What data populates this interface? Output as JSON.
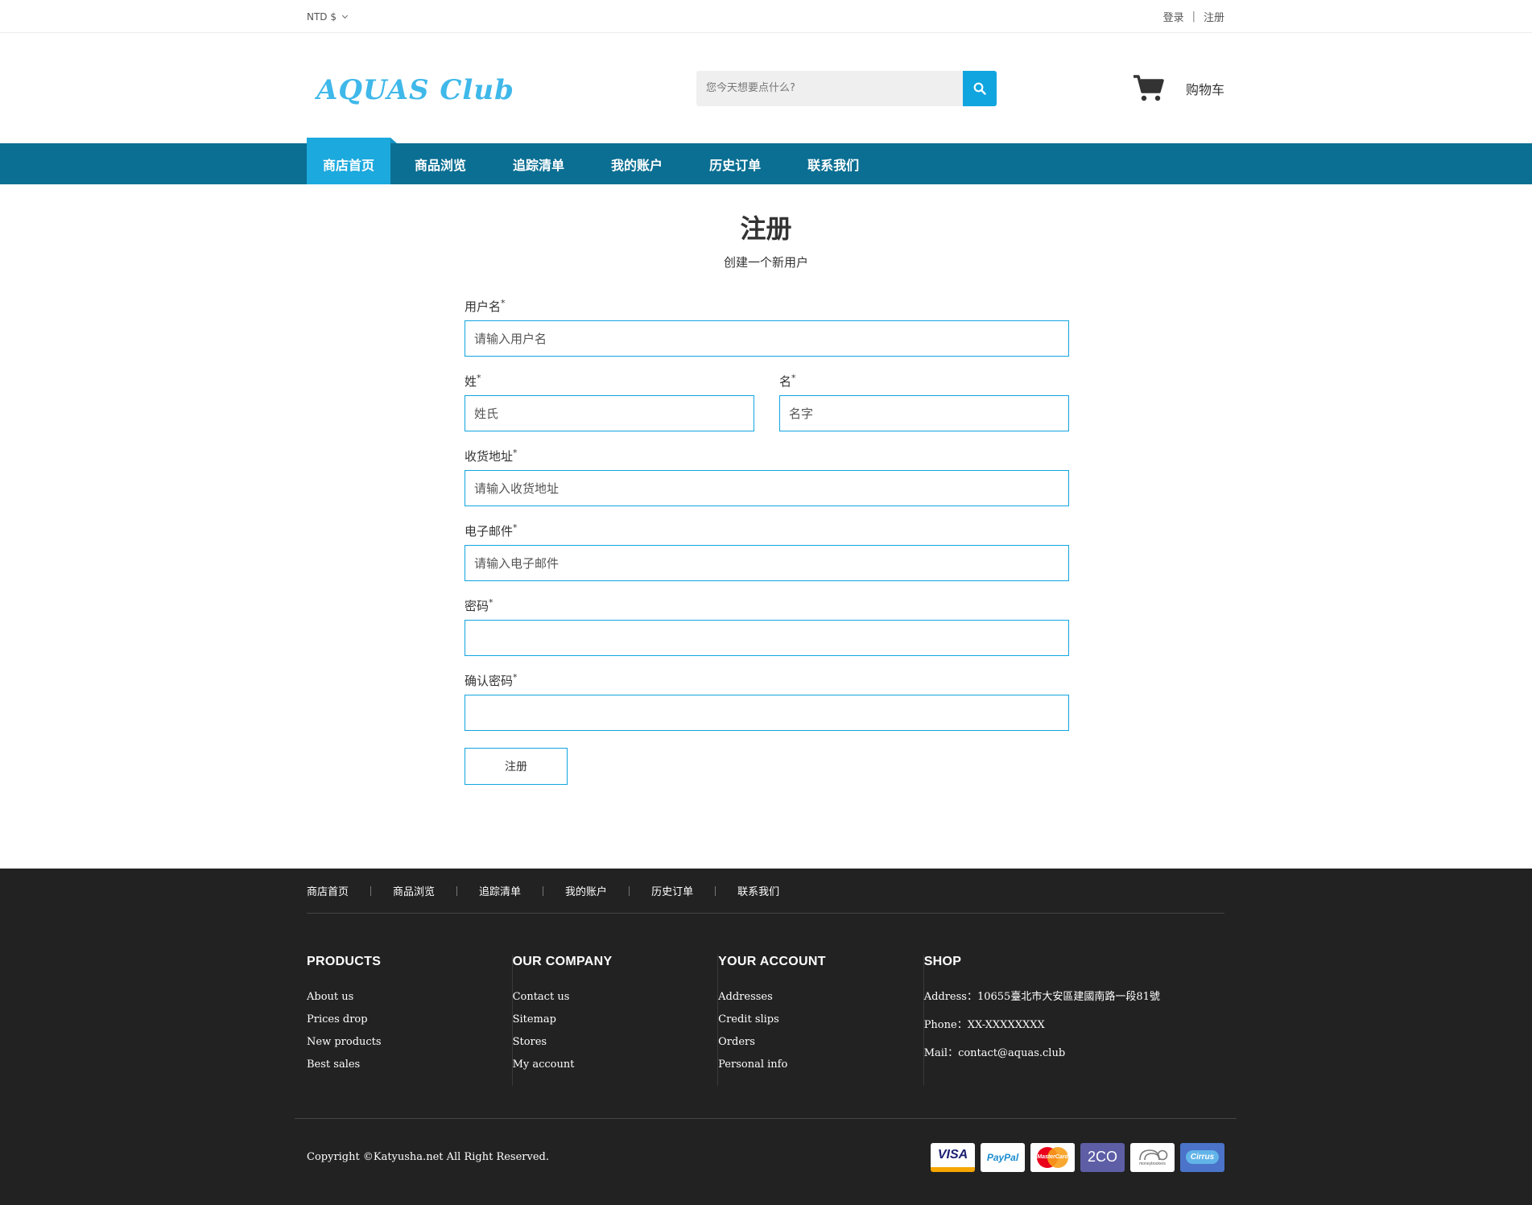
{
  "topbar": {
    "currency": "NTD $",
    "login": "登录",
    "separator": "|",
    "register": "注册"
  },
  "header": {
    "logo_text": "AQUAS Club",
    "search_placeholder": "您今天想要点什么?",
    "cart_label": "购物车"
  },
  "nav": {
    "items": [
      {
        "label": "商店首页",
        "active": true
      },
      {
        "label": "商品浏览"
      },
      {
        "label": "追踪清单"
      },
      {
        "label": "我的账户"
      },
      {
        "label": "历史订单"
      },
      {
        "label": "联系我们"
      }
    ]
  },
  "page": {
    "title": "注册",
    "subtitle": "创建一个新用户"
  },
  "form": {
    "required_mark": "*",
    "username": {
      "label": "用户名",
      "placeholder": "请输入用户名"
    },
    "lastname": {
      "label": "姓",
      "placeholder": "姓氏"
    },
    "firstname": {
      "label": "名",
      "placeholder": "名字"
    },
    "address": {
      "label": "收货地址",
      "placeholder": "请输入收货地址"
    },
    "email": {
      "label": "电子邮件",
      "placeholder": "请输入电子邮件"
    },
    "password": {
      "label": "密码"
    },
    "confirm_password": {
      "label": "确认密码"
    },
    "submit_label": "注册"
  },
  "footer": {
    "nav": [
      "商店首页",
      "商品浏览",
      "追踪清单",
      "我的账户",
      "历史订单",
      "联系我们"
    ],
    "products": {
      "title": "PRODUCTS",
      "items": [
        "About us",
        "Prices drop",
        "New products",
        "Best sales"
      ]
    },
    "company": {
      "title": "OUR COMPANY",
      "items": [
        "Contact us",
        "Sitemap",
        "Stores",
        "My account"
      ]
    },
    "account": {
      "title": "YOUR ACCOUNT",
      "items": [
        "Addresses",
        "Credit slips",
        "Orders",
        "Personal info"
      ]
    },
    "shop": {
      "title": "SHOP",
      "address": "Address：10655臺北市大安區建國南路一段81號",
      "phone": "Phone：XX-XXXXXXXX",
      "mail": "Mail：contact@aquas.club"
    },
    "copyright": "Copyright ©Katyusha.net All Right Reserved.",
    "payments": [
      "VISA",
      "PayPal",
      "MasterCard",
      "2CO",
      "moneybookers",
      "Cirrus"
    ]
  },
  "colors": {
    "accent": "#11a5e0",
    "nav_bg": "#0b6f93",
    "nav_active": "#1ba9de",
    "footer_bg": "#222222"
  }
}
